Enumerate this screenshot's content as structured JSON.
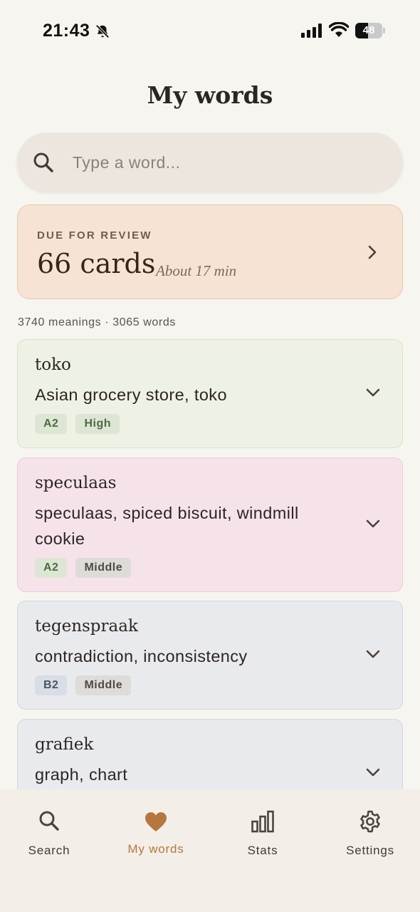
{
  "status_bar": {
    "time": "21:43",
    "battery_level": "48",
    "battery_fraction": 0.48
  },
  "header": {
    "title": "My words"
  },
  "search": {
    "placeholder": "Type a word..."
  },
  "review": {
    "label": "DUE FOR REVIEW",
    "count": "66 cards",
    "time": "About 17 min"
  },
  "summary": "3740 meanings · 3065 words",
  "words": [
    {
      "term": "toko",
      "meaning": "Asian grocery store, toko",
      "level": "A2",
      "frequency": "High",
      "bg": "#eef2e4",
      "border": "#d9e2c9"
    },
    {
      "term": "speculaas",
      "meaning": "speculaas, spiced biscuit, windmill cookie",
      "level": "A2",
      "frequency": "Middle",
      "bg": "#f6e3ea",
      "border": "#ebcdd8"
    },
    {
      "term": "tegenspraak",
      "meaning": "contradiction, inconsistency",
      "level": "B2",
      "frequency": "Middle",
      "bg": "#e9eaee",
      "border": "#d5d7de"
    },
    {
      "term": "grafiek",
      "meaning": "graph, chart",
      "level": "",
      "frequency": "",
      "bg": "#e9eaee",
      "border": "#d5d7de"
    }
  ],
  "tab_bar": {
    "tabs": [
      {
        "label": "Search",
        "icon": "search-icon"
      },
      {
        "label": "My words",
        "icon": "heart-icon",
        "active": true
      },
      {
        "label": "Stats",
        "icon": "bar-chart-icon"
      },
      {
        "label": "Settings",
        "icon": "gear-icon"
      }
    ]
  },
  "colors": {
    "accent": "#b5773f",
    "background": "#f7f5f0",
    "review_card": "#f6e3d4",
    "tag_a2_bg": "#dde6d4",
    "tag_b2_bg": "#d8dde6",
    "tag_freq_bg_green": "#dde6d4",
    "tag_freq_bg_grey": "#dedcd8"
  }
}
